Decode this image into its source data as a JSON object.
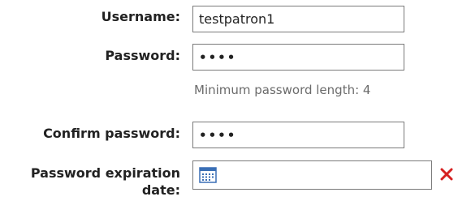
{
  "form": {
    "username": {
      "label": "Username:",
      "value": "testpatron1"
    },
    "password": {
      "label": "Password:",
      "value": "••••",
      "hint": "Minimum password length: 4"
    },
    "confirm_password": {
      "label": "Confirm password:",
      "value": "••••"
    },
    "expiration": {
      "label_line1": "Password expiration",
      "label_line2": "date:",
      "value": ""
    }
  },
  "icons": {
    "calendar": "calendar-icon",
    "clear": "close-icon"
  },
  "colors": {
    "border": "#7a7a7a",
    "label": "#222222",
    "hint": "#6b6b6b",
    "clear": "#d62020",
    "calendar": "#3a6fb5"
  }
}
